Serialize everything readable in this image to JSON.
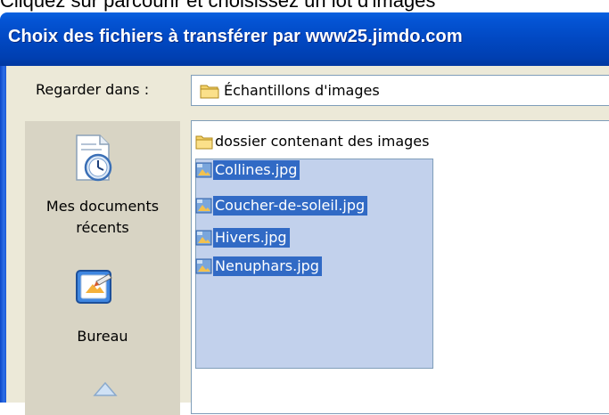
{
  "caption": {
    "text": "Cliquez sur parcourir et choisissez un lot d'images"
  },
  "window": {
    "title": "Choix des fichiers à transférer par www25.jimdo.com"
  },
  "lookin": {
    "label": "Regarder dans :",
    "value": "Échantillons d'images",
    "icon": "folder-icon"
  },
  "places": [
    {
      "label_line1": "Mes documents",
      "label_line2": "récents",
      "icon": "recent-documents-icon"
    },
    {
      "label_line1": "Bureau",
      "icon": "desktop-icon"
    }
  ],
  "files": {
    "folder": {
      "name": "dossier contenant des images",
      "icon": "folder-icon"
    },
    "items": [
      {
        "name": "Collines.jpg",
        "icon": "jpg-image-icon",
        "selected": true
      },
      {
        "name": "Coucher-de-soleil.jpg",
        "icon": "jpg-image-icon",
        "selected": true
      },
      {
        "name": "Hivers.jpg",
        "icon": "jpg-image-icon",
        "selected": true
      },
      {
        "name": "Nenuphars.jpg",
        "icon": "jpg-image-icon",
        "selected": true
      }
    ]
  },
  "colors": {
    "title_bar": "#0148c2",
    "selection": "#316ac5",
    "dialog_bg": "#ece9d8",
    "marquee": "#c2d1ec"
  }
}
